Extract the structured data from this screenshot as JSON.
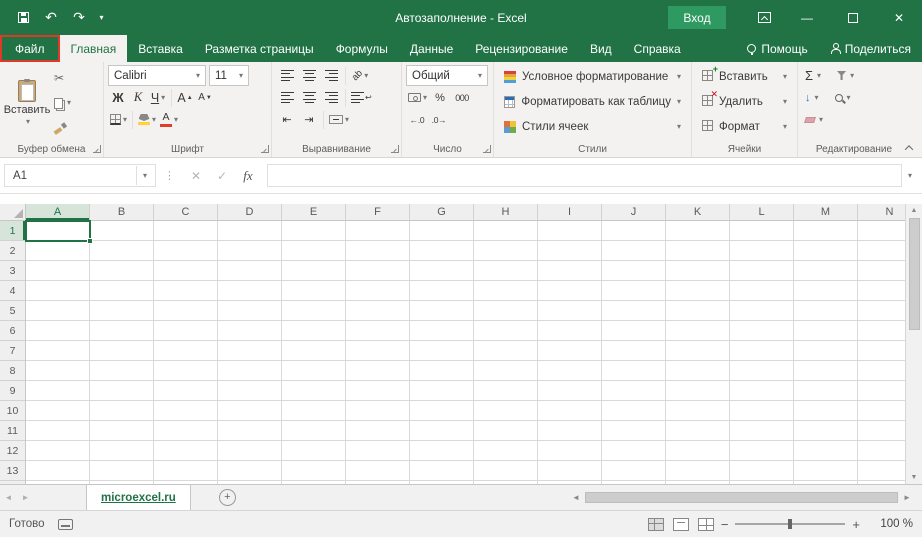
{
  "title_bar": {
    "title": "Автозаполнение - Excel",
    "sign_in": "Вход"
  },
  "ribbon_tabs": [
    {
      "label": "Файл"
    },
    {
      "label": "Главная"
    },
    {
      "label": "Вставка"
    },
    {
      "label": "Разметка страницы"
    },
    {
      "label": "Формулы"
    },
    {
      "label": "Данные"
    },
    {
      "label": "Рецензирование"
    },
    {
      "label": "Вид"
    },
    {
      "label": "Справка"
    },
    {
      "label": "Помощь"
    },
    {
      "label": "Поделиться"
    }
  ],
  "ribbon": {
    "clipboard": {
      "label": "Буфер обмена",
      "paste": "Вставить"
    },
    "font": {
      "label": "Шрифт",
      "font_name": "Calibri",
      "font_size": "11",
      "bold": "Ж",
      "italic": "К",
      "underline": "Ч",
      "letter": "А"
    },
    "alignment": {
      "label": "Выравнивание"
    },
    "number": {
      "label": "Число",
      "format": "Общий"
    },
    "styles": {
      "label": "Стили",
      "conditional": "Условное форматирование",
      "format_table": "Форматировать как таблицу",
      "cell_styles": "Стили ячеек"
    },
    "cells": {
      "label": "Ячейки",
      "insert": "Вставить",
      "delete": "Удалить",
      "format": "Формат"
    },
    "editing": {
      "label": "Редактирование"
    }
  },
  "formula_bar": {
    "name_box": "A1",
    "fx": "fx"
  },
  "grid": {
    "columns": [
      "A",
      "B",
      "C",
      "D",
      "E",
      "F",
      "G",
      "H",
      "I",
      "J",
      "K",
      "L",
      "M",
      "N"
    ],
    "rows": [
      "1",
      "2",
      "3",
      "4",
      "5",
      "6",
      "7",
      "8",
      "9",
      "10",
      "11",
      "12",
      "13"
    ],
    "selected_cell": "A1",
    "selected_column": "A",
    "selected_row": "1"
  },
  "sheet_bar": {
    "sheet_name": "microexcel.ru"
  },
  "status_bar": {
    "ready": "Готово",
    "zoom": "100 %"
  },
  "icons": {
    "dropdown": "▾",
    "undo": "↶",
    "redo": "↷",
    "cut": "✂",
    "sum": "Σ",
    "percent": "%",
    "zeros": "000",
    "increase_decimal": "←.0",
    "decrease_decimal": ".0→",
    "orientation": "ab",
    "wrap_arrow": "↩",
    "indent_decrease": "⇤",
    "indent_increase": "⇥",
    "fill_down": "↓",
    "minimize": "—",
    "close": "✕",
    "check": "✓",
    "cancel": "✕",
    "plus": "+",
    "minus": "−",
    "up_small": "▲",
    "down_small": "▼",
    "left_arrow": "◄",
    "right_arrow": "►",
    "dots": "⋮"
  },
  "colors": {
    "accent": "#217346",
    "selection_border": "#217346",
    "annotation_box": "#dd3a27",
    "signin_button": "#2e9a62"
  }
}
